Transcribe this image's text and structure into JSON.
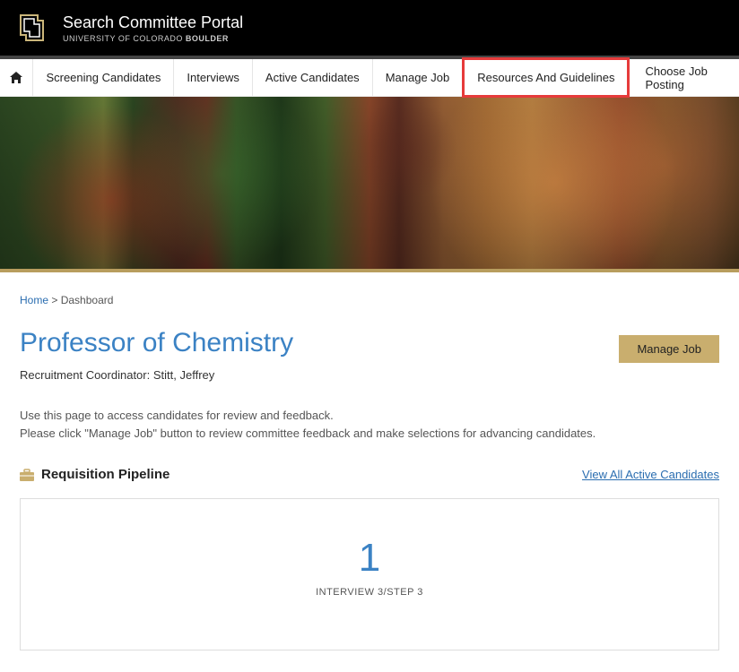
{
  "header": {
    "title": "Search Committee Portal",
    "subtitle_prefix": "UNIVERSITY OF COLORADO ",
    "subtitle_bold": "BOULDER"
  },
  "nav": {
    "items": [
      {
        "label": "Screening Candidates"
      },
      {
        "label": "Interviews"
      },
      {
        "label": "Active Candidates"
      },
      {
        "label": "Manage Job"
      },
      {
        "label": "Resources And Guidelines"
      }
    ],
    "choose_label": "Choose Job Posting"
  },
  "breadcrumb": {
    "home": "Home",
    "sep": ">",
    "current": "Dashboard"
  },
  "job": {
    "title": "Professor of Chemistry",
    "coordinator_label": "Recruitment Coordinator:",
    "coordinator_name": "Stitt, Jeffrey",
    "manage_button": "Manage Job",
    "desc_line1": "Use this page to access candidates for review and feedback.",
    "desc_line2": "Please click \"Manage Job\" button to review committee feedback and make selections for advancing candidates."
  },
  "pipeline": {
    "section_title": "Requisition Pipeline",
    "view_all": "View All Active Candidates",
    "count": "1",
    "step_label": "INTERVIEW 3/STEP 3"
  },
  "colors": {
    "accent_blue": "#3b82c4",
    "link_blue": "#2a6db0",
    "gold_button": "#c9ae6e",
    "highlight_red": "#e63b3b"
  }
}
